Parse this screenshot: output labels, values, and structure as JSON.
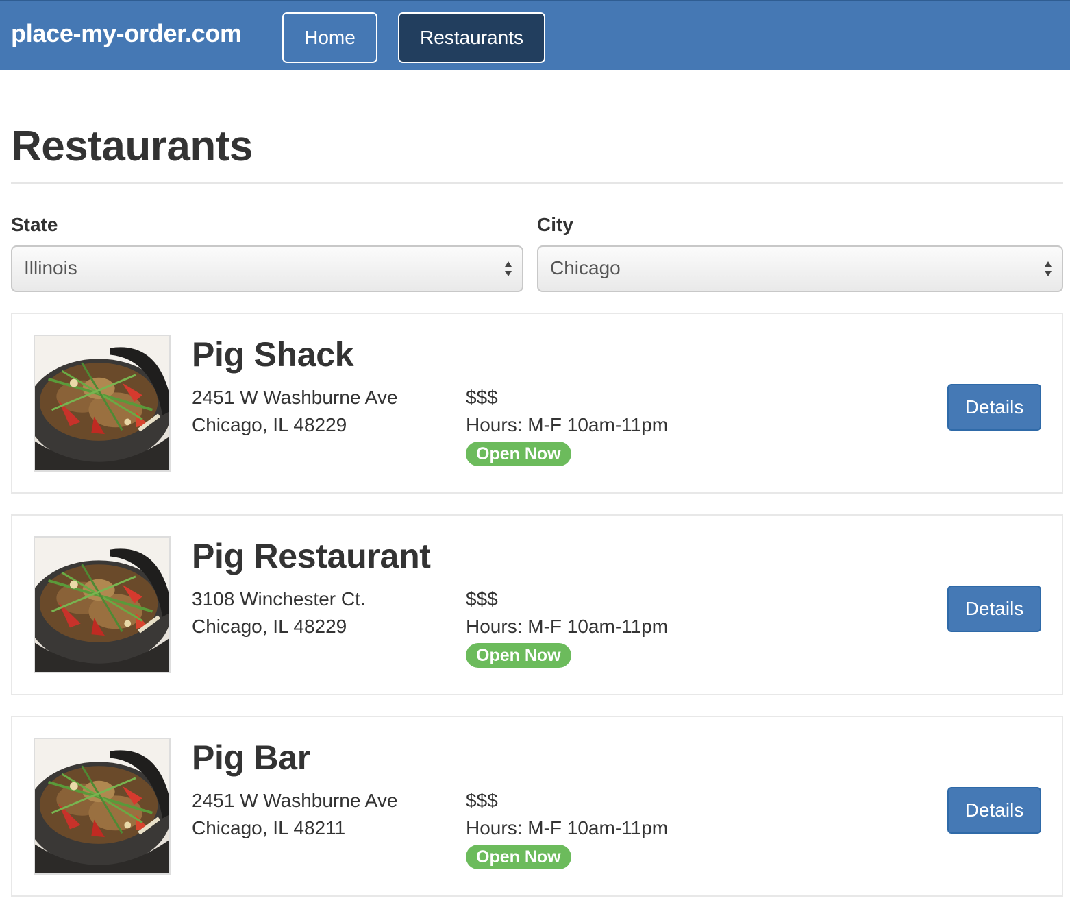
{
  "navbar": {
    "brand": "place-my-order.com",
    "links": [
      {
        "label": "Home",
        "active": false
      },
      {
        "label": "Restaurants",
        "active": true
      }
    ]
  },
  "page": {
    "title": "Restaurants"
  },
  "filters": {
    "state": {
      "label": "State",
      "value": "Illinois"
    },
    "city": {
      "label": "City",
      "value": "Chicago"
    }
  },
  "restaurants": [
    {
      "name": "Pig Shack",
      "street": "2451 W Washburne Ave",
      "city_line": "Chicago, IL 48229",
      "price": "$$$",
      "hours": "Hours: M-F 10am-11pm",
      "status": "Open Now",
      "button": "Details",
      "image_icon": "food-dish-thumbnail"
    },
    {
      "name": "Pig Restaurant",
      "street": "3108 Winchester Ct.",
      "city_line": "Chicago, IL 48229",
      "price": "$$$",
      "hours": "Hours: M-F 10am-11pm",
      "status": "Open Now",
      "button": "Details",
      "image_icon": "food-dish-thumbnail"
    },
    {
      "name": "Pig Bar",
      "street": "2451 W Washburne Ave",
      "city_line": "Chicago, IL 48211",
      "price": "$$$",
      "hours": "Hours: M-F 10am-11pm",
      "status": "Open Now",
      "button": "Details",
      "image_icon": "food-dish-thumbnail"
    }
  ],
  "colors": {
    "navbar": "#4578b4",
    "active_nav": "#223e5e",
    "primary_button": "#4579b5",
    "open_badge": "#6cbb5c"
  }
}
